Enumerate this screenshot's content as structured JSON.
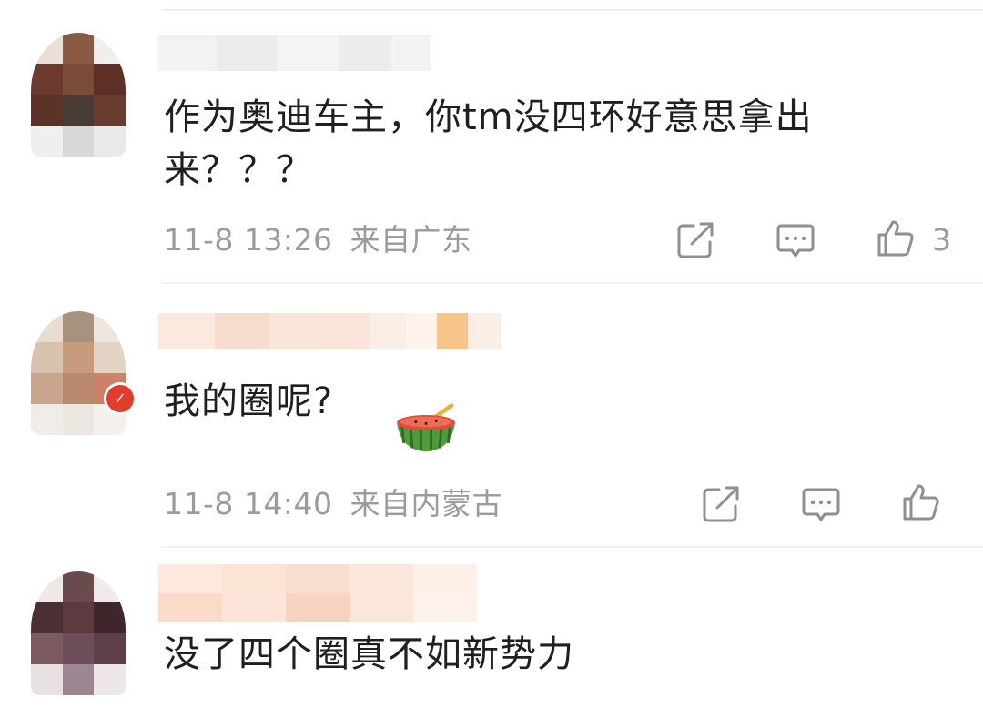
{
  "comments": [
    {
      "text_line1": "作为奥迪车主，你tm没四环好意思拿出",
      "text_line2": "来？？？",
      "time": "11-8 13:26",
      "location": "来自广东",
      "likes": "3"
    },
    {
      "text": "我的圈呢?",
      "emoji": "watermelon-emoji",
      "time": "11-8 14:40",
      "location": "来自内蒙古",
      "likes": ""
    },
    {
      "text": "没了四个圈真不如新势力"
    }
  ],
  "icons": {
    "share": "share-icon",
    "comment": "comment-icon",
    "like": "thumbs-up-icon"
  },
  "colors": {
    "text": "#1f1f1f",
    "meta": "#9b9b9b",
    "badge": "#e23d2b",
    "divider": "#f0f0f0"
  }
}
